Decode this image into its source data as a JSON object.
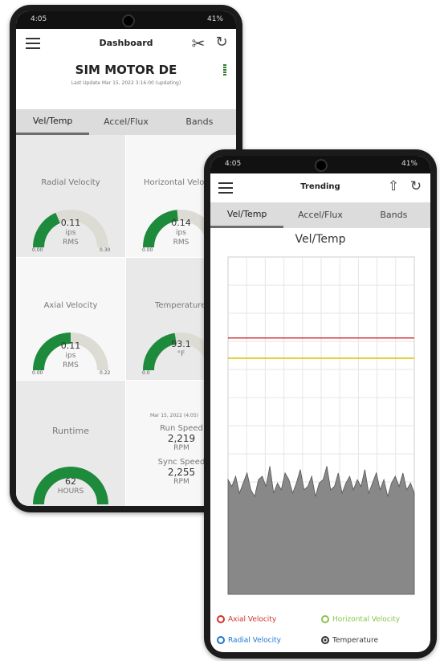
{
  "dashboard": {
    "status": {
      "time": "4:05",
      "right": "41%"
    },
    "app_title": "Dashboard",
    "motor_name": "SIM MOTOR DE",
    "last_update": "Last Update Mar 15, 2022 3:16:00 (updating)",
    "tabs": [
      "Vel/Temp",
      "Accel/Flux",
      "Bands"
    ],
    "active_tab": 0,
    "gauges": [
      {
        "label": "Radial Velocity",
        "value": "0.11",
        "unit": "ips",
        "sub": "RMS",
        "min": "0.00",
        "max": "0.30",
        "fill": 0.37,
        "color": "#1e8a3c"
      },
      {
        "label": "Horizontal Veloc",
        "value": "0.14",
        "unit": "ips",
        "sub": "RMS",
        "min": "0.00",
        "max": "",
        "fill": 0.47,
        "color": "#1e8a3c"
      },
      {
        "label": "Axial Velocity",
        "value": "0.11",
        "unit": "ips",
        "sub": "RMS",
        "min": "0.00",
        "max": "0.22",
        "fill": 0.5,
        "color": "#1e8a3c"
      },
      {
        "label": "Temperature",
        "value": "93.1",
        "unit": "°F",
        "sub": "",
        "min": "0.0",
        "max": "",
        "fill": 0.45,
        "color": "#1e8a3c"
      }
    ],
    "runtime": {
      "label": "Runtime",
      "value": "62",
      "unit": "HOURS"
    },
    "speeds": {
      "date": "Mar 15, 2022 (4:05)",
      "run_label": "Run Speed",
      "run_value": "2,219",
      "run_unit": "RPM",
      "sync_label": "Sync Speed",
      "sync_value": "2,255",
      "sync_unit": "RPM"
    }
  },
  "trending": {
    "status": {
      "time": "4:05",
      "right": "41%"
    },
    "app_title": "Trending",
    "tabs": [
      "Vel/Temp",
      "Accel/Flux",
      "Bands"
    ],
    "active_tab": 0,
    "chart_title": "Vel/Temp",
    "legend": [
      {
        "label": "Axial Velocity",
        "color": "#d32f2f"
      },
      {
        "label": "Horizontal Velocity",
        "color": "#8bc34a"
      },
      {
        "label": "Radial Velocity",
        "color": "#1976d2"
      },
      {
        "label": "Temperature",
        "color": "#333333"
      }
    ]
  },
  "chart_data": {
    "type": "area",
    "title": "Vel/Temp",
    "xlabel": "",
    "ylabel": "",
    "grid": true,
    "reference_lines": [
      {
        "color": "#d32f2f",
        "level_fraction": 0.76
      },
      {
        "color": "#e0c100",
        "level_fraction": 0.7
      }
    ],
    "series": [
      {
        "name": "Temperature",
        "color": "#888888",
        "values": [
          0.34,
          0.32,
          0.35,
          0.3,
          0.33,
          0.36,
          0.31,
          0.29,
          0.34,
          0.35,
          0.32,
          0.38,
          0.3,
          0.33,
          0.31,
          0.36,
          0.34,
          0.3,
          0.33,
          0.37,
          0.31,
          0.32,
          0.35,
          0.29,
          0.33,
          0.34,
          0.38,
          0.31,
          0.32,
          0.36,
          0.3,
          0.33,
          0.35,
          0.31,
          0.34,
          0.32,
          0.37,
          0.3,
          0.33,
          0.36,
          0.31,
          0.34,
          0.29,
          0.33,
          0.35,
          0.32,
          0.36,
          0.31,
          0.33,
          0.3
        ]
      }
    ]
  }
}
